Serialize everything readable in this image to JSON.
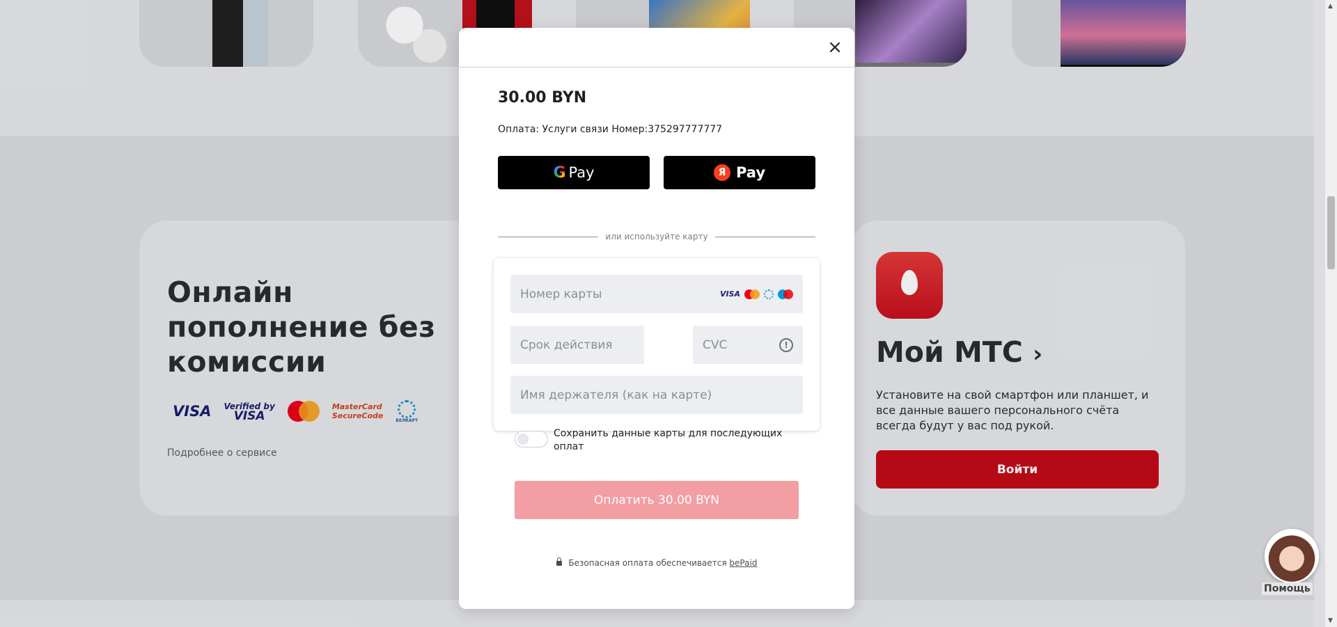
{
  "background": {
    "promo": {
      "title": "Онлайн пополнение без комиссии",
      "logos": {
        "visa": "VISA",
        "verified_line1": "Verified by",
        "verified_line2": "VISA",
        "mastercard_sc_line1": "MasterCard",
        "mastercard_sc_line2": "SecureCode",
        "belkart": "БЕЛКАРТ"
      },
      "link": "Подробнее о сервисе"
    },
    "app": {
      "title": "Мой МТС",
      "chevron": "›",
      "description": "Установите на свой смартфон или планшет, и все данные вашего персонального счёта всегда будут у вас под рукой.",
      "login_label": "Войти"
    },
    "assistant_label": "Помощь",
    "colors": {
      "brand_red": "#c30b17",
      "pay_button_disabled": "#f39ea3"
    }
  },
  "modal": {
    "close_icon": "×",
    "amount": "30.00 BYN",
    "purpose": "Оплата: Услуги связи Номер:375297777777",
    "google_pay": {
      "g": "G",
      "label": "Pay"
    },
    "yandex_pay": {
      "ya": "Я",
      "label": "Pay"
    },
    "divider_text": "или используйте карту",
    "card_brands": {
      "visa": "VISA"
    },
    "fields": {
      "card_number_placeholder": "Номер карты",
      "expiry_placeholder": "Срок действия",
      "cvc_placeholder": "CVC",
      "holder_placeholder": "Имя держателя (как на карте)"
    },
    "info_icon": "!",
    "save_card_label": "Сохранить данные карты для последующих оплат",
    "pay_button_label": "Оплатить 30.00 BYN",
    "secure_text": "Безопасная оплата обеспечивается",
    "secure_provider": "bePaid"
  }
}
